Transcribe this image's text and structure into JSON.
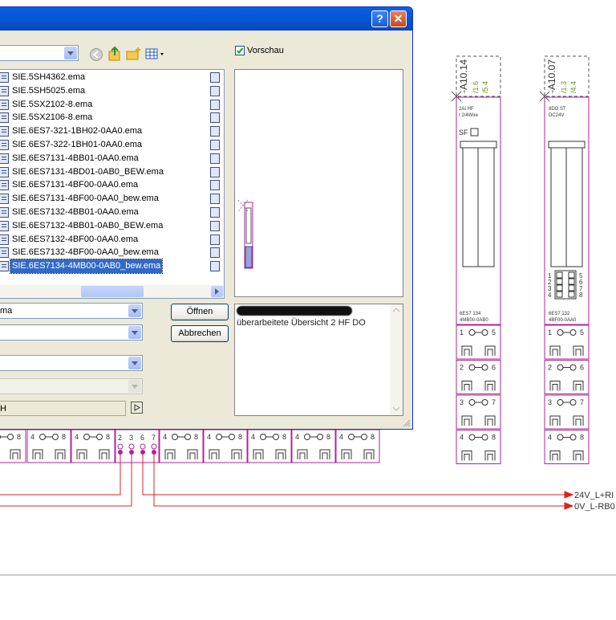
{
  "preview_checkbox": {
    "label": "Vorschau",
    "checked": true
  },
  "files": [
    "SIE.5SH4362.ema",
    "SIE.5SH5025.ema",
    "SIE.5SX2102-8.ema",
    "SIE.5SX2106-8.ema",
    "SIE.6ES7-321-1BH02-0AA0.ema",
    "SIE.6ES7-322-1BH01-0AA0.ema",
    "SIE.6ES7131-4BB01-0AA0.ema",
    "SIE.6ES7131-4BD01-0AB0_BEW.ema",
    "SIE.6ES7131-4BF00-0AA0.ema",
    "SIE.6ES7131-4BF00-0AA0_bew.ema",
    "SIE.6ES7132-4BB01-0AA0.ema",
    "SIE.6ES7132-4BB01-0AB0_BEW.ema",
    "SIE.6ES7132-4BF00-0AA0.ema",
    "SIE.6ES7132-4BF00-0AA0_bew.ema",
    "SIE.6ES7134-4MB00-0AB0_bew.ema"
  ],
  "selected_index": 14,
  "filename_value": "ma",
  "path_value": "H",
  "buttons": {
    "open": "Öffnen",
    "cancel": "Abbrechen"
  },
  "description": "überarbeitete Übersicht 2 HF DO",
  "schematic": {
    "module1": {
      "tag": "-A10.14",
      "refs": [
        "/1.6",
        "/5.4"
      ],
      "line1": "2AI    HF",
      "line2": "I 2/4Wire",
      "sf": "SF",
      "bottom1": "6ES7 134",
      "bottom2": "4MB00-0AB0"
    },
    "module2": {
      "tag": "-A10.07",
      "refs": [
        "/1.3",
        "/4.4"
      ],
      "line1": "8DO ST",
      "line2": "DC24V",
      "bottom1": "6ES7 132",
      "bottom2": "4BF00-0AA0"
    },
    "terminal_rows": [
      {
        "left": "1",
        "right": "5"
      },
      {
        "left": "2",
        "right": "6"
      },
      {
        "left": "3",
        "right": "7"
      },
      {
        "left": "4",
        "right": "8"
      }
    ],
    "bottom_terminal": {
      "left": "4",
      "right": "8"
    },
    "pins": [
      "2",
      "3",
      "6",
      "7"
    ],
    "dig_left": [
      "1",
      "2",
      "3",
      "4"
    ],
    "dig_right": [
      "5",
      "6",
      "7",
      "8"
    ],
    "wire_24v": "24V_L+RI",
    "wire_0v": "0V_L-RB0"
  },
  "colors": {
    "schematic_line": "#b2229a",
    "wire": "#e02020",
    "selection": "#316ac5"
  }
}
